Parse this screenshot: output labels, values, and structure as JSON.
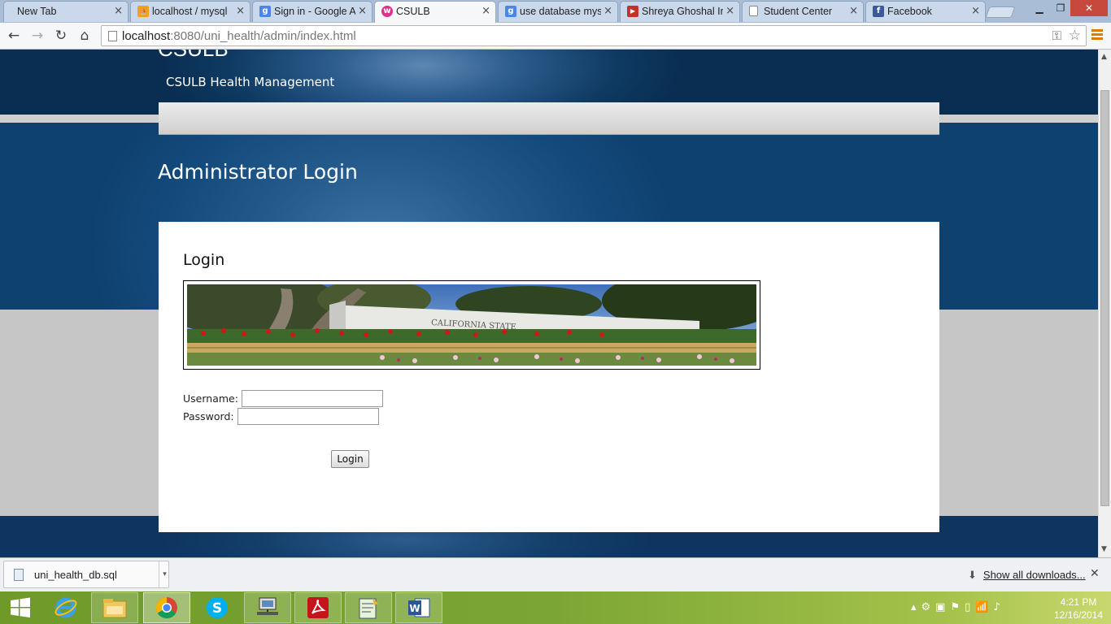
{
  "browser": {
    "tabs": [
      {
        "title": "New Tab",
        "icon": "blank",
        "active": false
      },
      {
        "title": "localhost / mysql",
        "icon": "phpmyadmin-icon",
        "active": false
      },
      {
        "title": "Sign in - Google A",
        "icon": "google-icon",
        "active": false
      },
      {
        "title": "CSULB",
        "icon": "csulb-icon",
        "active": true
      },
      {
        "title": "use database mysq",
        "icon": "google-icon",
        "active": false
      },
      {
        "title": "Shreya Ghoshal In",
        "icon": "youtube-icon",
        "active": false
      },
      {
        "title": "Student Center",
        "icon": "page-icon",
        "active": false
      },
      {
        "title": "Facebook",
        "icon": "facebook-icon",
        "active": false
      }
    ],
    "url_host": "localhost",
    "url_rest": ":8080/uni_health/admin/index.html",
    "tab_close_glyph": "×"
  },
  "site": {
    "name": "CSULB",
    "tagline": "CSULB Health Management",
    "page_title": "Administrator Login"
  },
  "login": {
    "heading": "Login",
    "username_label": "Username:",
    "password_label": "Password:",
    "username_value": "",
    "password_value": "",
    "button_label": "Login",
    "banner_sign_text": "CALIFORNIA STATE UNIVERSITY LONG BEACH"
  },
  "downloads": {
    "file_name": "uni_health_db.sql",
    "show_all": "Show all downloads..."
  },
  "taskbar": {
    "apps": [
      "start-icon",
      "internet-explorer-icon",
      "file-explorer-icon",
      "chrome-icon",
      "skype-icon",
      "network-icon",
      "acrobat-icon",
      "notepad-icon",
      "word-icon"
    ],
    "time": "4:21 PM",
    "date": "12/16/2014"
  },
  "colors": {
    "header_blue": "#0e3a62",
    "band_blue": "#1b5185",
    "taskbar_green": "#7ca634"
  }
}
